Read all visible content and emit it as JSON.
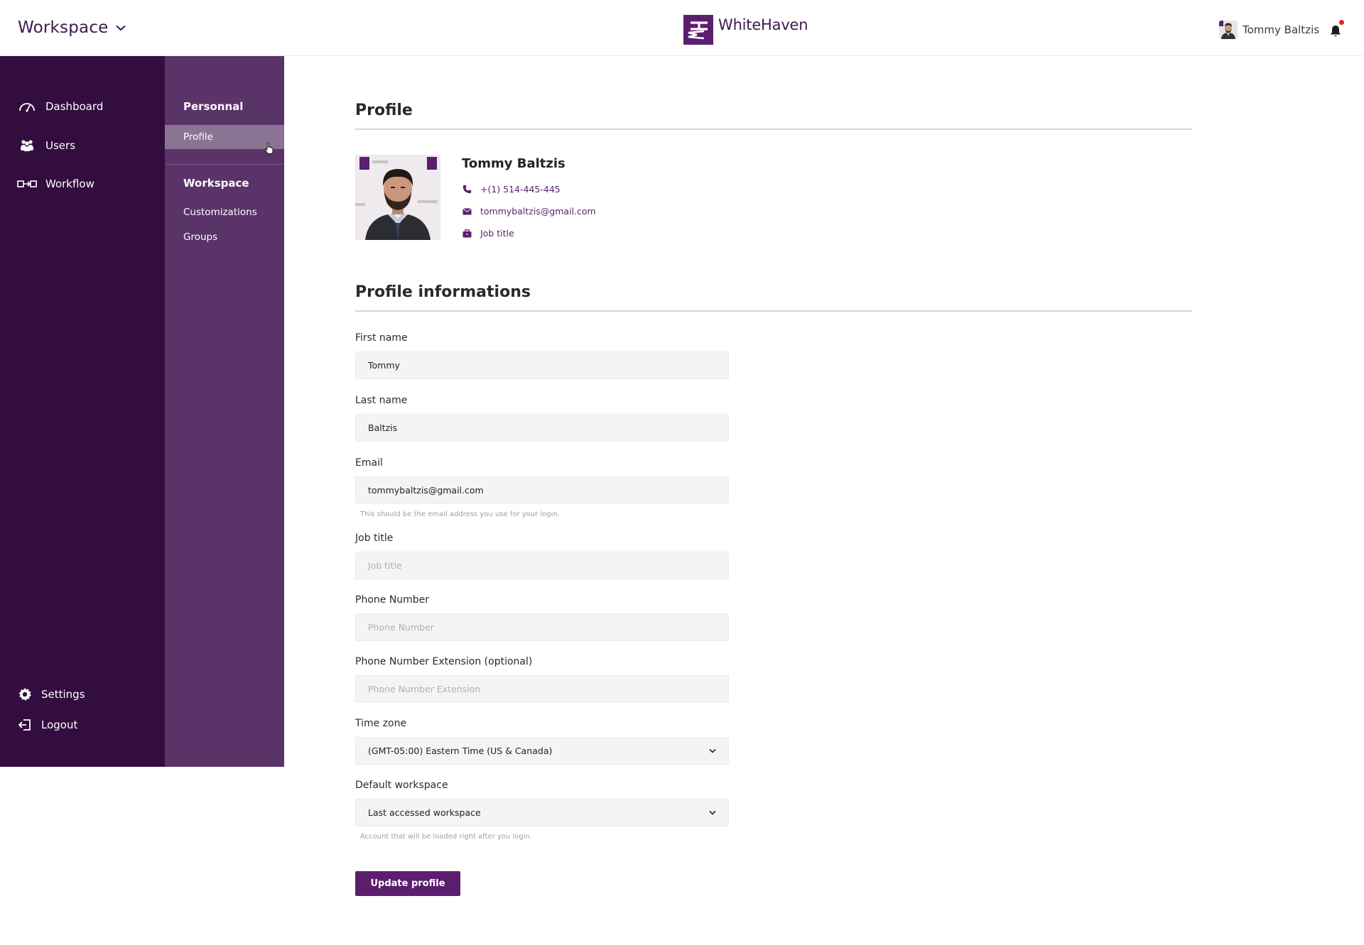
{
  "topbar": {
    "workspace_label": "Workspace",
    "brand_name": "WhiteHaven",
    "user_name": "Tommy Baltzis"
  },
  "sidebar": {
    "items": [
      {
        "label": "Dashboard",
        "icon": "gauge-icon"
      },
      {
        "label": "Users",
        "icon": "users-icon"
      },
      {
        "label": "Workflow",
        "icon": "workflow-icon"
      }
    ],
    "bottom": [
      {
        "label": "Settings",
        "icon": "gear-icon"
      },
      {
        "label": "Logout",
        "icon": "logout-icon"
      }
    ]
  },
  "subnav": {
    "personal_title": "Personnal",
    "profile_link": "Profile",
    "workspace_title": "Workspace",
    "customizations_link": "Customizations",
    "groups_link": "Groups"
  },
  "profile": {
    "section_title": "Profile",
    "name": "Tommy Baltzis",
    "phone": "+(1) 514-445-445",
    "email": "tommybaltzis@gmail.com",
    "job_title": "Job title"
  },
  "form": {
    "section_title": "Profile informations",
    "first_name": {
      "label": "First name",
      "value": "Tommy"
    },
    "last_name": {
      "label": "Last name",
      "value": "Baltzis"
    },
    "email": {
      "label": "Email",
      "value": "tommybaltzis@gmail.com",
      "help": "This should be the email address you use for your login."
    },
    "job_title": {
      "label": "Job title",
      "value": "",
      "placeholder": "Job title"
    },
    "phone": {
      "label": "Phone Number",
      "value": "",
      "placeholder": "Phone Number"
    },
    "phone_ext": {
      "label": "Phone Number Extension  (optional)",
      "value": "",
      "placeholder": "Phone Number Extension"
    },
    "timezone": {
      "label": "Time zone",
      "value": "(GMT-05:00) Eastern Time (US & Canada)"
    },
    "default_workspace": {
      "label": "Default workspace",
      "value": "Last accessed workspace",
      "help": "Account that will be loaded right after you login."
    },
    "submit_label": "Update profile"
  },
  "colors": {
    "brand": "#5b1f6e",
    "sidebar_dark": "#330d3f",
    "sidebar_secondary": "#5a3369",
    "active_item": "#8b7393",
    "notification": "#e02424"
  }
}
